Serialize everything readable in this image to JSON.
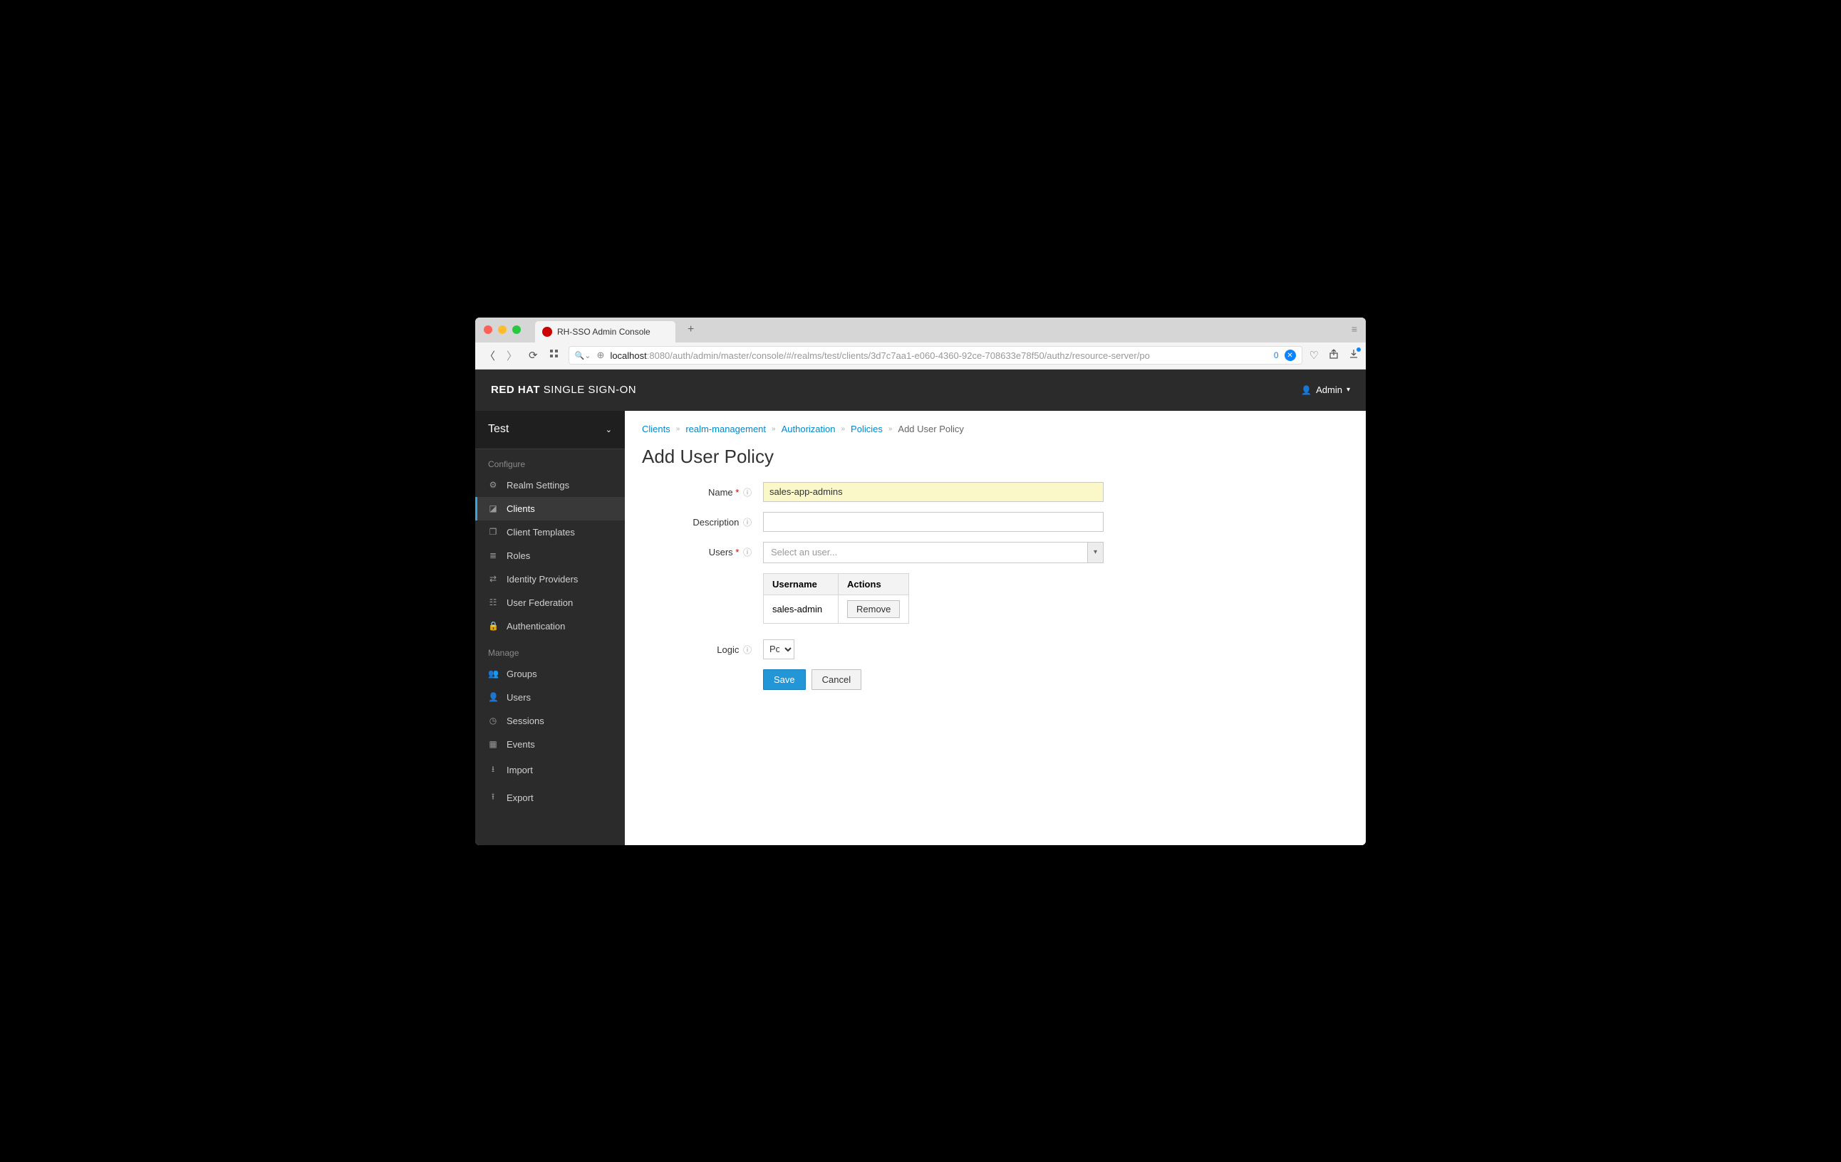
{
  "browser": {
    "tab_title": "RH-SSO Admin Console",
    "url_host": "localhost",
    "url_path": ":8080/auth/admin/master/console/#/realms/test/clients/3d7c7aa1-e060-4360-92ce-708633e78f50/authz/resource-server/po",
    "tab_count": "0"
  },
  "header": {
    "brand_strong": "RED HAT",
    "brand_rest": " SINGLE SIGN-ON",
    "user": "Admin"
  },
  "sidebar": {
    "realm": "Test",
    "sections": {
      "configure": "Configure",
      "manage": "Manage"
    },
    "items": {
      "realm_settings": "Realm Settings",
      "clients": "Clients",
      "client_templates": "Client Templates",
      "roles": "Roles",
      "identity_providers": "Identity Providers",
      "user_federation": "User Federation",
      "authentication": "Authentication",
      "groups": "Groups",
      "users": "Users",
      "sessions": "Sessions",
      "events": "Events",
      "import": "Import",
      "export": "Export"
    }
  },
  "breadcrumbs": {
    "clients": "Clients",
    "realm_mgmt": "realm-management",
    "authorization": "Authorization",
    "policies": "Policies",
    "current": "Add User Policy"
  },
  "page": {
    "title": "Add User Policy"
  },
  "form": {
    "labels": {
      "name": "Name",
      "description": "Description",
      "users": "Users",
      "logic": "Logic"
    },
    "name_value": "sales-app-admins",
    "description_value": "",
    "users_placeholder": "Select an user...",
    "logic_value": "Pos",
    "table": {
      "col_username": "Username",
      "col_actions": "Actions",
      "rows": [
        {
          "username": "sales-admin"
        }
      ]
    },
    "buttons": {
      "remove": "Remove",
      "save": "Save",
      "cancel": "Cancel"
    }
  }
}
